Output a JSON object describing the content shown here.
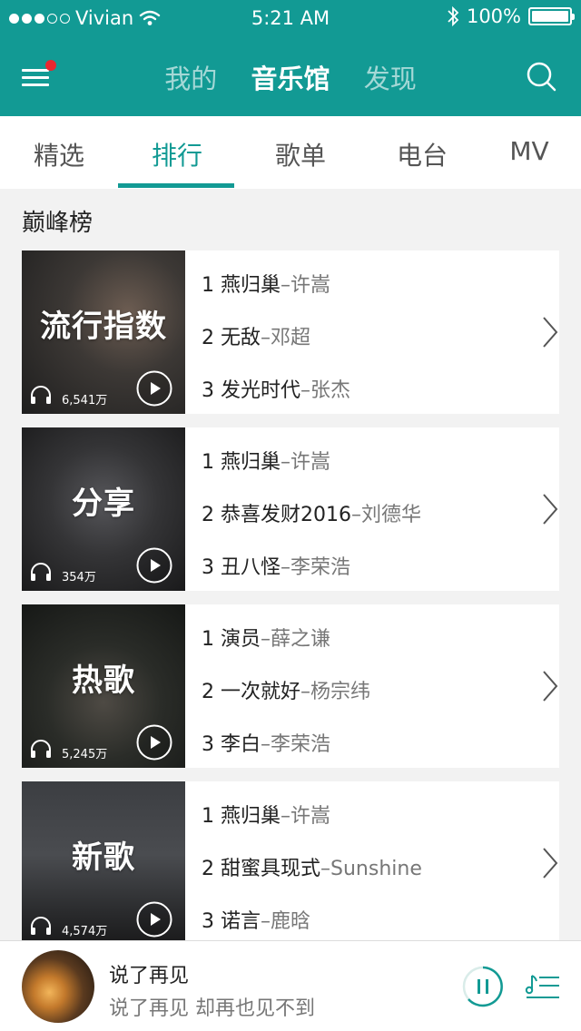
{
  "status_bar": {
    "carrier": "Vivian",
    "time": "5:21 AM",
    "battery": "100%"
  },
  "nav": {
    "tabs": [
      "我的",
      "音乐馆",
      "发现"
    ],
    "active_index": 1
  },
  "category_tabs": {
    "tabs": [
      "精选",
      "排行",
      "歌单",
      "电台",
      "MV"
    ],
    "active_index": 1
  },
  "section_title": "巅峰榜",
  "charts": [
    {
      "cover_label": "流行指数",
      "plays": "6,541万",
      "songs": [
        {
          "rank": "1",
          "title": "燕归巢",
          "artist": "–许嵩"
        },
        {
          "rank": "2",
          "title": "无敌",
          "artist": "–邓超"
        },
        {
          "rank": "3",
          "title": "发光时代",
          "artist": "–张杰"
        }
      ]
    },
    {
      "cover_label": "分享",
      "plays": "354万",
      "songs": [
        {
          "rank": "1",
          "title": "燕归巢",
          "artist": "–许嵩"
        },
        {
          "rank": "2",
          "title": "恭喜发财2016",
          "artist": "–刘德华"
        },
        {
          "rank": "3",
          "title": "丑八怪",
          "artist": "–李荣浩"
        }
      ]
    },
    {
      "cover_label": "热歌",
      "plays": "5,245万",
      "songs": [
        {
          "rank": "1",
          "title": "演员",
          "artist": "–薛之谦"
        },
        {
          "rank": "2",
          "title": "一次就好",
          "artist": "–杨宗纬"
        },
        {
          "rank": "3",
          "title": "李白",
          "artist": "–李荣浩"
        }
      ]
    },
    {
      "cover_label": "新歌",
      "plays": "4,574万",
      "songs": [
        {
          "rank": "1",
          "title": "燕归巢",
          "artist": "–许嵩"
        },
        {
          "rank": "2",
          "title": "甜蜜具现式",
          "artist": "–Sunshine"
        },
        {
          "rank": "3",
          "title": "诺言",
          "artist": "–鹿晗"
        }
      ]
    }
  ],
  "player": {
    "title": "说了再见",
    "subtitle": "说了再见 却再也见不到"
  },
  "colors": {
    "accent": "#129a94",
    "notification": "#e9272f"
  },
  "icons": {
    "menu": "menu-icon",
    "search": "search-icon",
    "play": "play-icon",
    "headphones": "headphones-icon",
    "chevron": "chevron-right-icon",
    "pause": "pause-icon",
    "playlist": "playlist-icon"
  }
}
